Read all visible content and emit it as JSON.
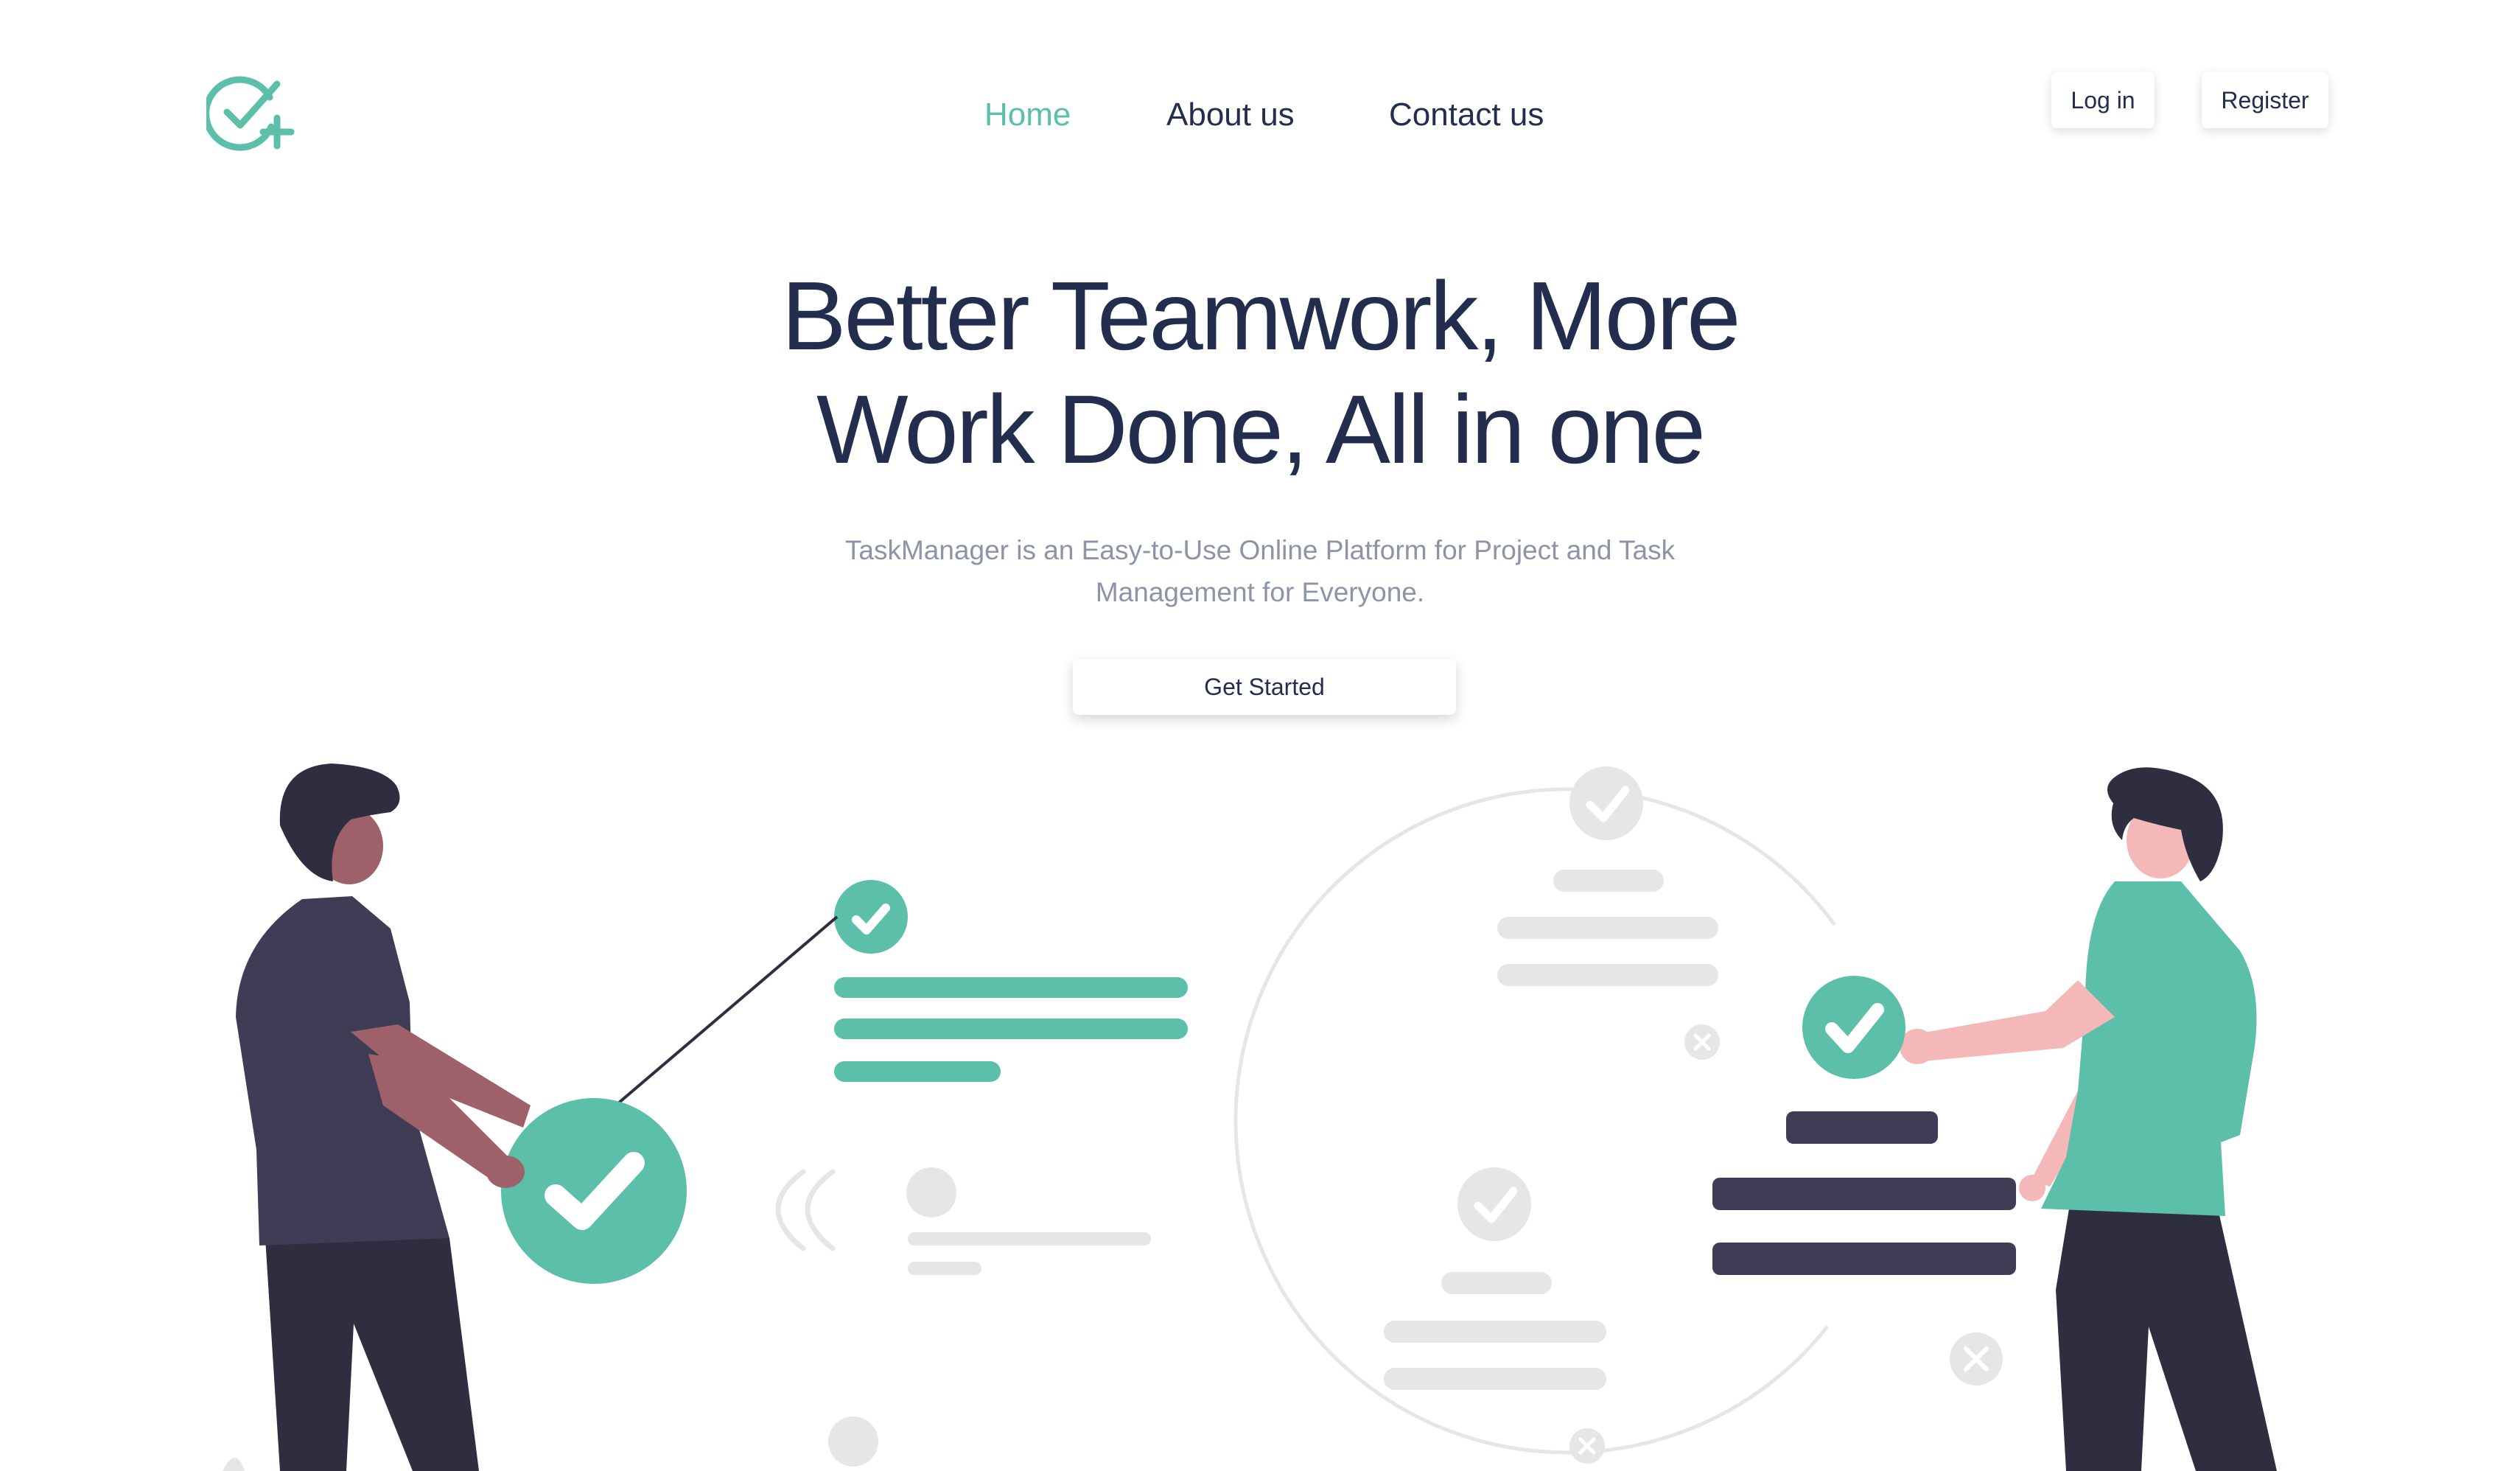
{
  "header": {
    "logo_icon": "check-circle-plus-icon",
    "nav": {
      "home": "Home",
      "about": "About us",
      "contact": "Contact us",
      "active": "home"
    },
    "login_label": "Log in",
    "register_label": "Register"
  },
  "hero": {
    "title_line1": "Better Teamwork, More",
    "title_line2": "Work Done, All in one",
    "subtitle_line1": "TaskManager is an Easy-to-Use Online Platform for Project and Task",
    "subtitle_line2": "Management for Everyone.",
    "cta_label": "Get Started"
  },
  "colors": {
    "accent": "#5bbfa9",
    "text_dark": "#232e4f",
    "text_muted": "#8c94a6",
    "figure_dark": "#3f3d56",
    "skin_dark": "#9e616a",
    "skin_light": "#f5b8b8",
    "placeholder_gray": "#e6e6e6"
  }
}
